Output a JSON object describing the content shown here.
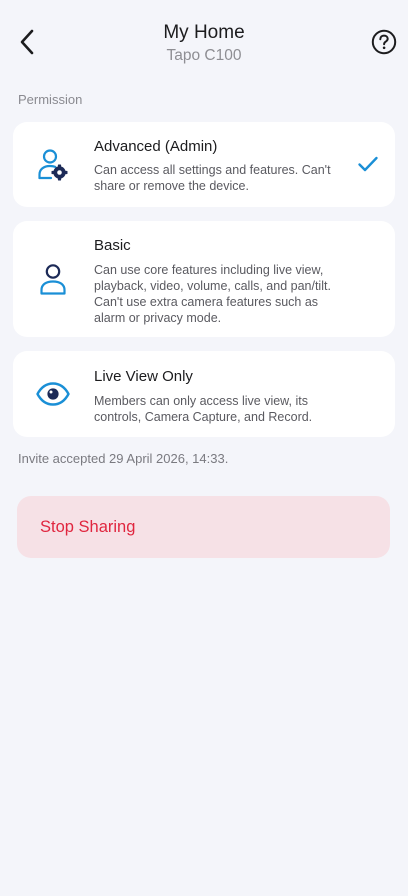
{
  "header": {
    "title": "My Home",
    "subtitle": "Tapo C100",
    "back_icon": "chevron-left-icon",
    "help_icon": "question-circle-icon"
  },
  "permission": {
    "section_label": "Permission",
    "options": [
      {
        "title": "Advanced (Admin)",
        "description": "Can access all settings and features. Can't share or remove the device.",
        "icon": "admin-user-gear-icon",
        "selected": true
      },
      {
        "title": "Basic",
        "description": "Can use core features including live view, playback, video, volume, calls, and pan/tilt. Can't use extra camera features such as alarm or privacy mode.",
        "icon": "user-icon",
        "selected": false
      },
      {
        "title": "Live View Only",
        "description": "Members can only access live view, its controls, Camera Capture, and Record.",
        "icon": "eye-icon",
        "selected": false
      }
    ]
  },
  "invite_note": "Invite accepted 29 April 2026, 14:33.",
  "stop_sharing_label": "Stop Sharing",
  "colors": {
    "background": "#f4f5fa",
    "accent_blue": "#1a8fd6",
    "dark_navy": "#1c2a57",
    "danger_text": "#e0263f",
    "danger_bg": "#f6e1e6"
  }
}
